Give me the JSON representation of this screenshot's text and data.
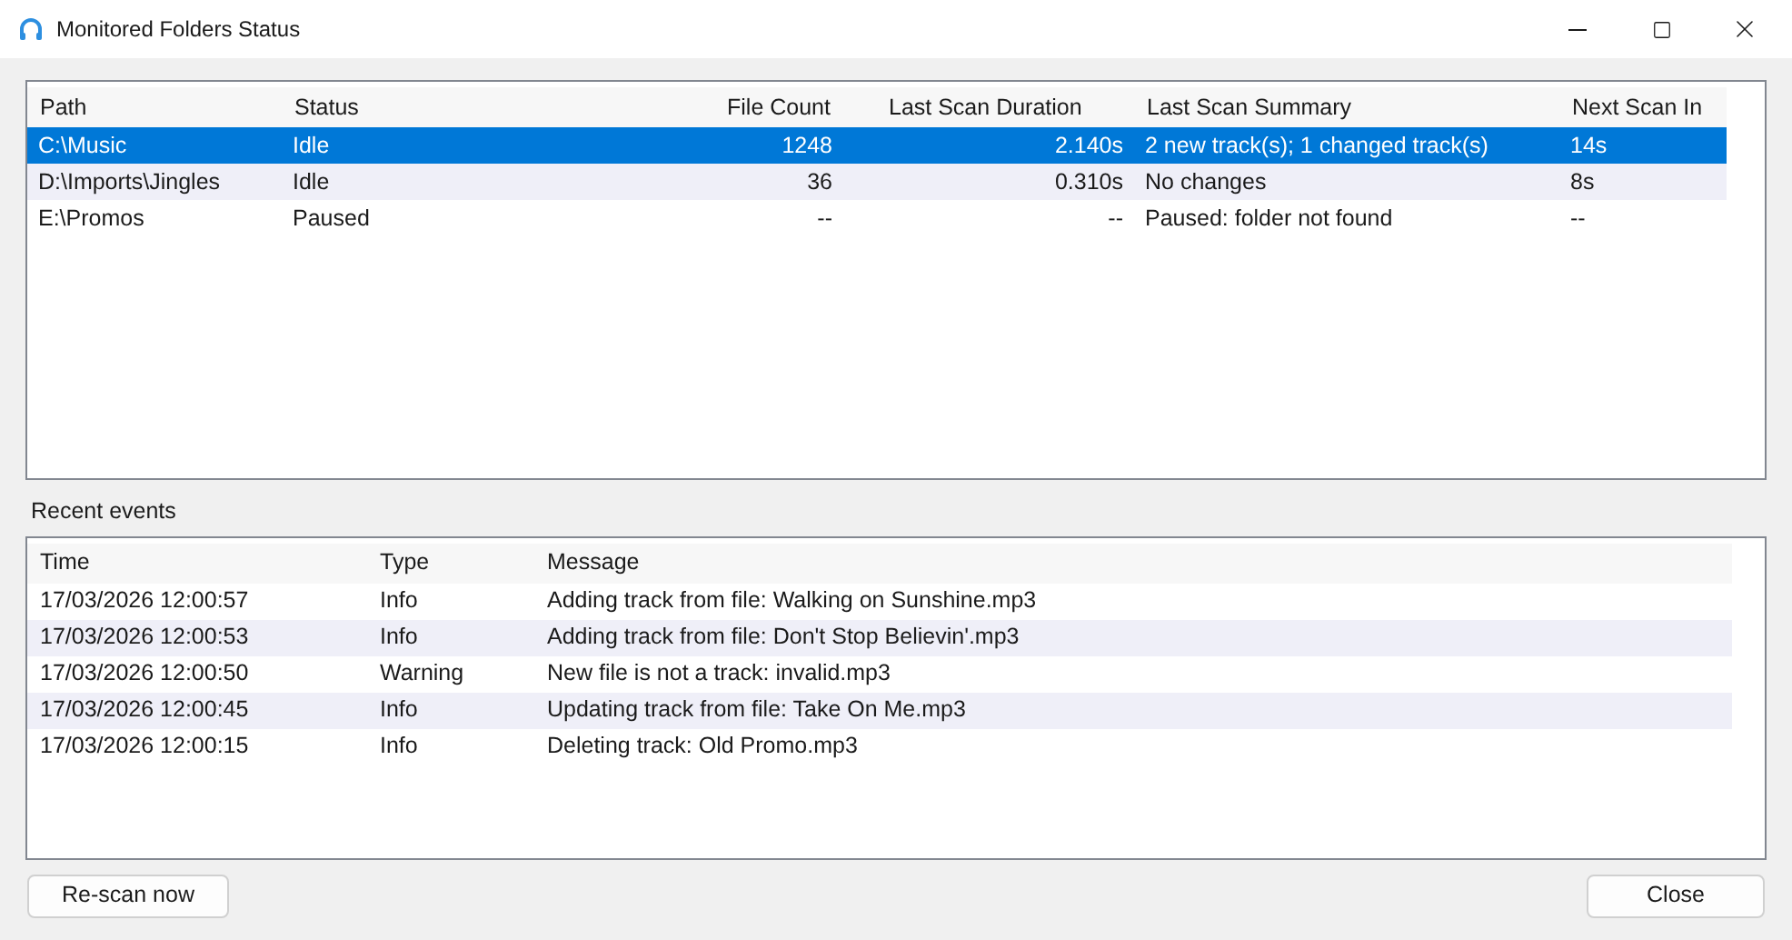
{
  "window": {
    "title": "Monitored Folders Status"
  },
  "folders": {
    "columns": [
      "Path",
      "Status",
      "File Count",
      "Last Scan Duration",
      "Last Scan Summary",
      "Next Scan In"
    ],
    "rows": [
      {
        "selected": true,
        "cells": [
          "C:\\Music",
          "Idle",
          "1248",
          "2.140s",
          "2 new track(s); 1 changed track(s)",
          "14s"
        ]
      },
      {
        "selected": false,
        "cells": [
          "D:\\Imports\\Jingles",
          "Idle",
          "36",
          "0.310s",
          "No changes",
          "8s"
        ]
      },
      {
        "selected": false,
        "cells": [
          "E:\\Promos",
          "Paused",
          "--",
          "--",
          "Paused: folder not found",
          "--"
        ]
      }
    ]
  },
  "events": {
    "label": "Recent events",
    "columns": [
      "Time",
      "Type",
      "Message"
    ],
    "rows": [
      {
        "cells": [
          "17/03/2026 12:00:57",
          "Info",
          "Adding track from file: Walking on Sunshine.mp3"
        ]
      },
      {
        "cells": [
          "17/03/2026 12:00:53",
          "Info",
          "Adding track from file: Don't Stop Believin'.mp3"
        ]
      },
      {
        "cells": [
          "17/03/2026 12:00:50",
          "Warning",
          "New file is not a track: invalid.mp3"
        ]
      },
      {
        "cells": [
          "17/03/2026 12:00:45",
          "Info",
          "Updating track from file: Take On Me.mp3"
        ]
      },
      {
        "cells": [
          "17/03/2026 12:00:15",
          "Info",
          "Deleting track: Old Promo.mp3"
        ]
      }
    ]
  },
  "buttons": {
    "rescan": "Re-scan now",
    "close": "Close"
  }
}
